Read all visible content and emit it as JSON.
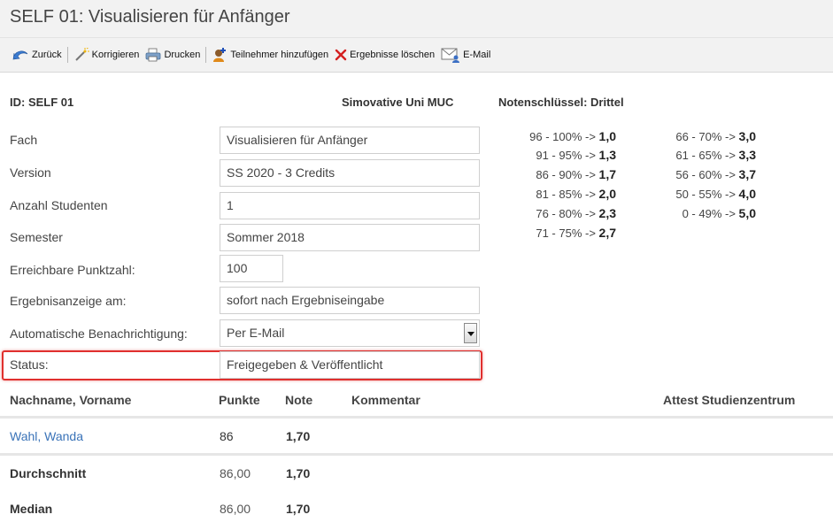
{
  "header": {
    "title": "SELF 01: Visualisieren für Anfänger"
  },
  "toolbar": {
    "zurueck": "Zurück",
    "korrigieren": "Korrigieren",
    "drucken": "Drucken",
    "teilnehmer": "Teilnehmer hinzufügen",
    "loeschen": "Ergebnisse löschen",
    "email": "E-Mail"
  },
  "info": {
    "id": "ID: SELF 01",
    "uni": "Simovative Uni MUC",
    "key_title": "Notenschlüssel: Drittel"
  },
  "form": {
    "fach_label": "Fach",
    "fach_value": "Visualisieren für Anfänger",
    "version_label": "Version",
    "version_value": "SS 2020 - 3 Credits",
    "anzahl_label": "Anzahl Studenten",
    "anzahl_value": "1",
    "semester_label": "Semester",
    "semester_value": "Sommer 2018",
    "punkte_label": "Erreichbare Punktzahl:",
    "punkte_value": "100",
    "anzeige_label": "Ergebnisanzeige am:",
    "anzeige_value": "sofort nach Ergebniseingabe",
    "benach_label": "Automatische Benachrichtigung:",
    "benach_value": "Per E-Mail",
    "status_label": "Status:",
    "status_value": "Freigegeben & Veröffentlicht"
  },
  "grades": {
    "left": [
      {
        "range": "96 - 100% -> ",
        "grade": "1,0"
      },
      {
        "range": "91 - 95% -> ",
        "grade": "1,3"
      },
      {
        "range": "86 - 90% -> ",
        "grade": "1,7"
      },
      {
        "range": "81 - 85% -> ",
        "grade": "2,0"
      },
      {
        "range": "76 - 80% -> ",
        "grade": "2,3"
      },
      {
        "range": "71 - 75% -> ",
        "grade": "2,7"
      }
    ],
    "right": [
      {
        "range": "66 - 70% -> ",
        "grade": "3,0"
      },
      {
        "range": "61 - 65% -> ",
        "grade": "3,3"
      },
      {
        "range": "56 - 60% -> ",
        "grade": "3,7"
      },
      {
        "range": "50 - 55% -> ",
        "grade": "4,0"
      },
      {
        "range": "0 - 49% -> ",
        "grade": "5,0"
      }
    ]
  },
  "table": {
    "headers": {
      "name": "Nachname, Vorname",
      "punkte": "Punkte",
      "note": "Note",
      "kommentar": "Kommentar",
      "attest": "Attest Studienzentrum"
    },
    "rows": [
      {
        "name": "Wahl, Wanda",
        "punkte": "86",
        "note": "1,70"
      }
    ],
    "summary": [
      {
        "label": "Durchschnitt",
        "punkte": "86,00",
        "note": "1,70"
      },
      {
        "label": "Median",
        "punkte": "86,00",
        "note": "1,70"
      }
    ]
  },
  "colors": {
    "link": "#3a73b8",
    "highlight": "#e0302e",
    "delete_icon": "#d42020"
  }
}
